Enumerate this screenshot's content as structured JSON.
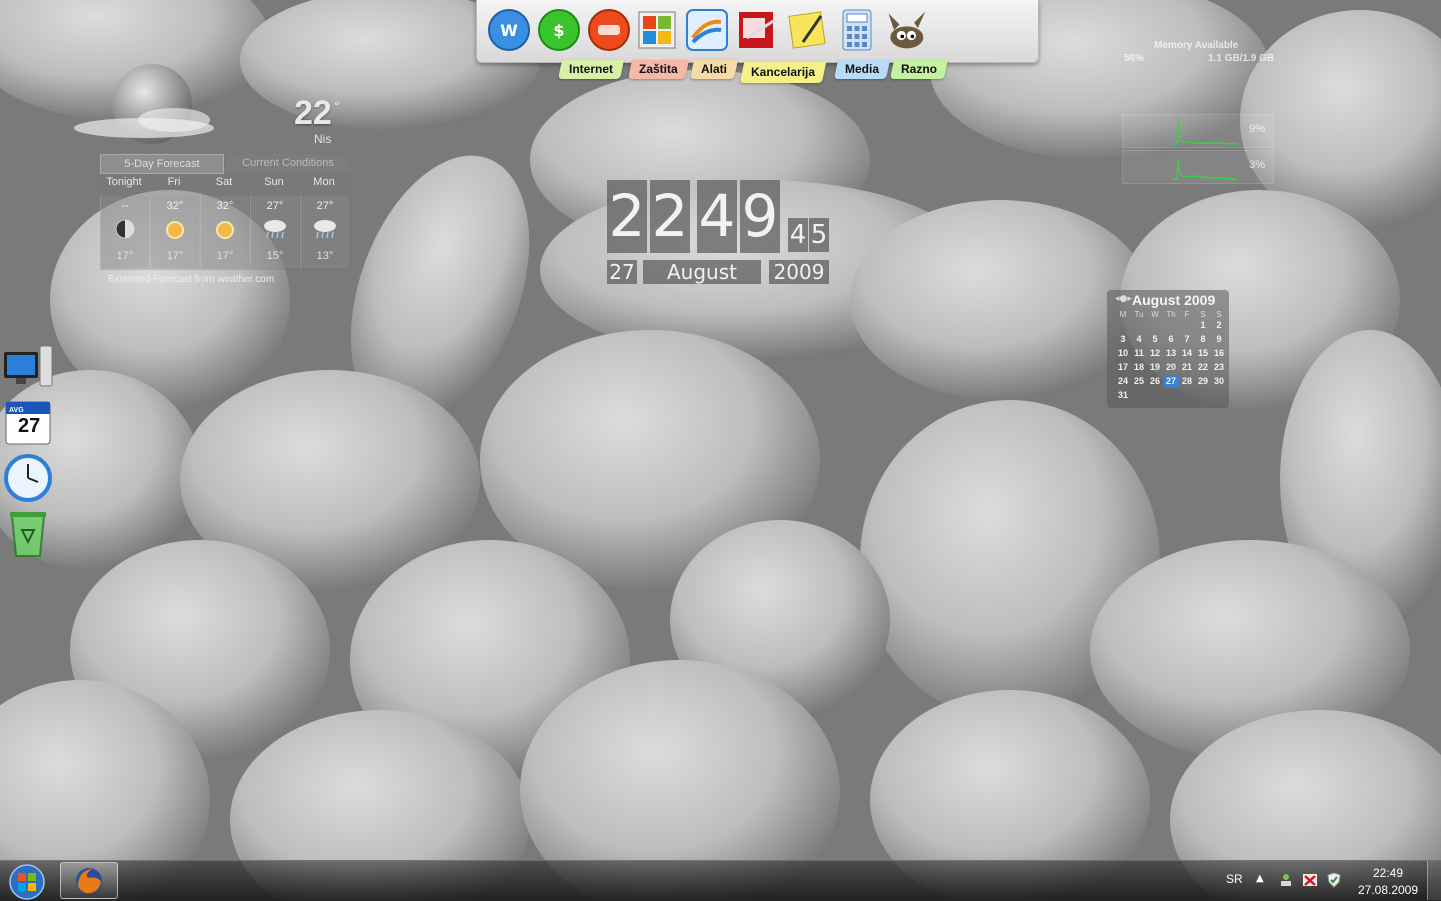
{
  "dock": {
    "icons": [
      "word-icon",
      "spreadsheet-icon",
      "presentation-icon",
      "office-icon",
      "chart-app-icon",
      "pdf-icon",
      "notes-icon",
      "calculator-icon",
      "gimp-icon"
    ],
    "tabs": [
      {
        "label": "Internet",
        "color": "#d9f0a8"
      },
      {
        "label": "Zaštita",
        "color": "#f4b7a8"
      },
      {
        "label": "Alati",
        "color": "#f5dba4"
      },
      {
        "label": "Kancelarija",
        "color": "#f6f08a"
      },
      {
        "label": "Media",
        "color": "#b9dbf5"
      },
      {
        "label": "Razno",
        "color": "#c4f0a2"
      }
    ]
  },
  "weather": {
    "temperature": "22",
    "degree": "°",
    "city": "Nis",
    "tabs": {
      "forecast": "5-Day Forecast",
      "current": "Current Conditions"
    },
    "days": [
      {
        "name": "Tonight",
        "high": "--",
        "low": "17°",
        "icon": "moon-icon"
      },
      {
        "name": "Fri",
        "high": "32°",
        "low": "17°",
        "icon": "sun-icon"
      },
      {
        "name": "Sat",
        "high": "32°",
        "low": "17°",
        "icon": "sun-icon"
      },
      {
        "name": "Sun",
        "high": "27°",
        "low": "15°",
        "icon": "rain-icon"
      },
      {
        "name": "Mon",
        "high": "27°",
        "low": "13°",
        "icon": "rain-icon"
      }
    ],
    "footer": "Extended Forecast from weather.com"
  },
  "clock": {
    "hour_digits": [
      "2",
      "2"
    ],
    "minute_digits": [
      "4",
      "9"
    ],
    "second_digits": [
      "4",
      "5"
    ],
    "day": "27",
    "month": "August",
    "year": "2009"
  },
  "memory": {
    "label": "Memory Available",
    "percent": "56%",
    "size": "1.1 GB/1.9 GB",
    "cpu_values": [
      "9%",
      "3%"
    ]
  },
  "calendar": {
    "nav": "◂●▸",
    "title": "August 2009",
    "weekdays": [
      "M",
      "Tu",
      "W",
      "Th",
      "F",
      "S",
      "S"
    ],
    "days": [
      "1",
      "2",
      "3",
      "4",
      "5",
      "6",
      "7",
      "8",
      "9",
      "10",
      "11",
      "12",
      "13",
      "14",
      "15",
      "16",
      "17",
      "18",
      "19",
      "20",
      "21",
      "22",
      "23",
      "24",
      "25",
      "26",
      "27",
      "28",
      "29",
      "30",
      "31"
    ],
    "first_weekday_index": 5,
    "today": "27"
  },
  "desktop": {
    "icons": [
      "computer-icon",
      "calendar-icon",
      "clock-icon",
      "recycle-bin-icon"
    ],
    "calendar_icon_month": "AVG",
    "calendar_icon_day": "27"
  },
  "taskbar": {
    "language": "SR",
    "tray_arrow": "▲",
    "time": "22:49",
    "date": "27.08.2009"
  }
}
